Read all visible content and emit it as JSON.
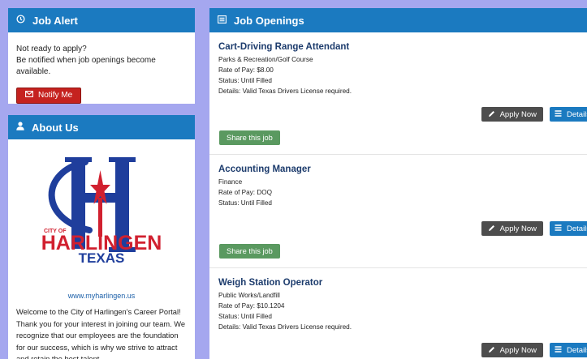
{
  "job_alert": {
    "title": "Job Alert",
    "line1": "Not ready to apply?",
    "line2": "Be notified when job openings become available.",
    "notify_label": "Notify Me"
  },
  "about_us": {
    "title": "About Us",
    "logo": {
      "city_of": "CITY OF",
      "harlingen": "HARLINGEN",
      "texas": "TEXAS"
    },
    "url": "www.myharlingen.us",
    "text": "Welcome to the City of Harlingen's Career Portal! Thank you for your interest in joining our team. We recognize that our employees are the foundation for our success, which is why we strive to attract and retain the best talent."
  },
  "job_openings": {
    "title": "Job Openings",
    "apply_label": "Apply Now",
    "details_label": "Details",
    "share_label": "Share this job",
    "jobs": [
      {
        "title": "Cart-Driving Range Attendant",
        "department": "Parks & Recreation/Golf Course",
        "rate": "Rate of Pay: $8.00",
        "status": "Status: Until Filled",
        "details": "Details: Valid Texas Drivers License required."
      },
      {
        "title": "Accounting Manager",
        "department": "Finance",
        "rate": "Rate of Pay: DOQ",
        "status": "Status: Until Filled",
        "details": ""
      },
      {
        "title": "Weigh Station Operator",
        "department": "Public Works/Landfill",
        "rate": "Rate of Pay: $10.1204",
        "status": "Status: Until Filled",
        "details": "Details: Valid Texas Drivers License required."
      }
    ]
  },
  "colors": {
    "header_blue": "#1b7ac0",
    "notify_red": "#c5221f",
    "share_green": "#5a9960",
    "apply_gray": "#4d4d4d",
    "background": "#a5a7ef",
    "logo_blue": "#1f3e9c",
    "logo_red": "#d1202f"
  },
  "icons": {
    "job_alert": "clock-icon",
    "about_us": "user-icon",
    "job_openings": "list-icon",
    "notify": "envelope-icon",
    "apply": "pencil-icon",
    "details": "list-icon"
  }
}
